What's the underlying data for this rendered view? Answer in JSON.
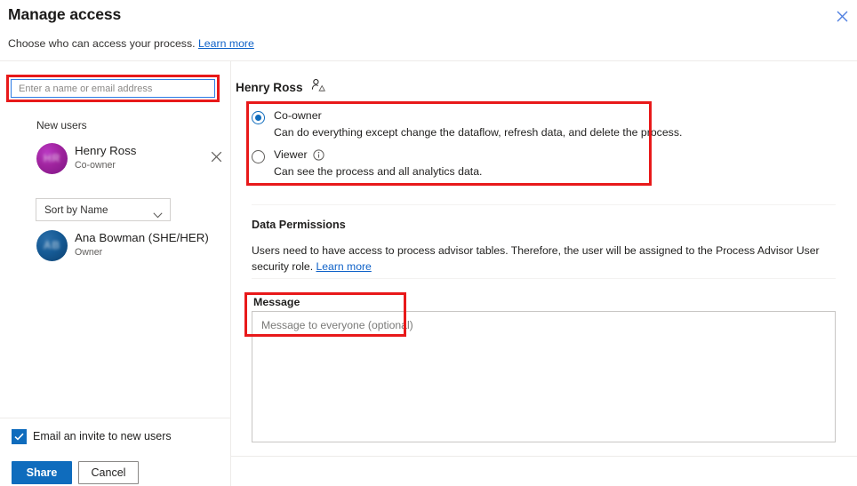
{
  "header": {
    "title": "Manage access",
    "subtitle_text": "Choose who can access your process.",
    "subtitle_link": "Learn more",
    "close_icon": "close-icon"
  },
  "left": {
    "search": {
      "placeholder": "Enter a name or email address",
      "value": ""
    },
    "new_users_label": "New users",
    "users": [
      {
        "name": "Henry Ross",
        "role": "Co-owner",
        "initials": "HR",
        "avatar_color": "#a0249f",
        "removable": true
      },
      {
        "name": "Ana Bowman (SHE/HER)",
        "role": "Owner",
        "initials": "AB",
        "avatar_color": "#165b96",
        "removable": false
      }
    ],
    "sort": {
      "selected": "Sort by Name",
      "options": [
        "Sort by Name"
      ]
    },
    "email_invite": {
      "label": "Email an invite to new users",
      "checked": true
    },
    "share_label": "Share",
    "cancel_label": "Cancel"
  },
  "right": {
    "person_name": "Henry Ross",
    "person_icon": "guest-user-icon",
    "permissions": [
      {
        "label": "Co-owner",
        "description": "Can do everything except change the dataflow, refresh data, and delete the process.",
        "selected": true,
        "has_info": false
      },
      {
        "label": "Viewer",
        "description": "Can see the process and all analytics data.",
        "selected": false,
        "has_info": true
      }
    ],
    "data_permissions": {
      "title": "Data Permissions",
      "body": "Users need to have access to process advisor tables. Therefore, the user will be assigned to the Process Advisor User security role. ",
      "link": "Learn more"
    },
    "message": {
      "label": "Message",
      "placeholder": "Message to everyone (optional)",
      "value": ""
    }
  },
  "colors": {
    "accent": "#0f6cbd",
    "link": "#0f62c8",
    "annotation": "#e8191a",
    "divider": "#edebe9"
  }
}
